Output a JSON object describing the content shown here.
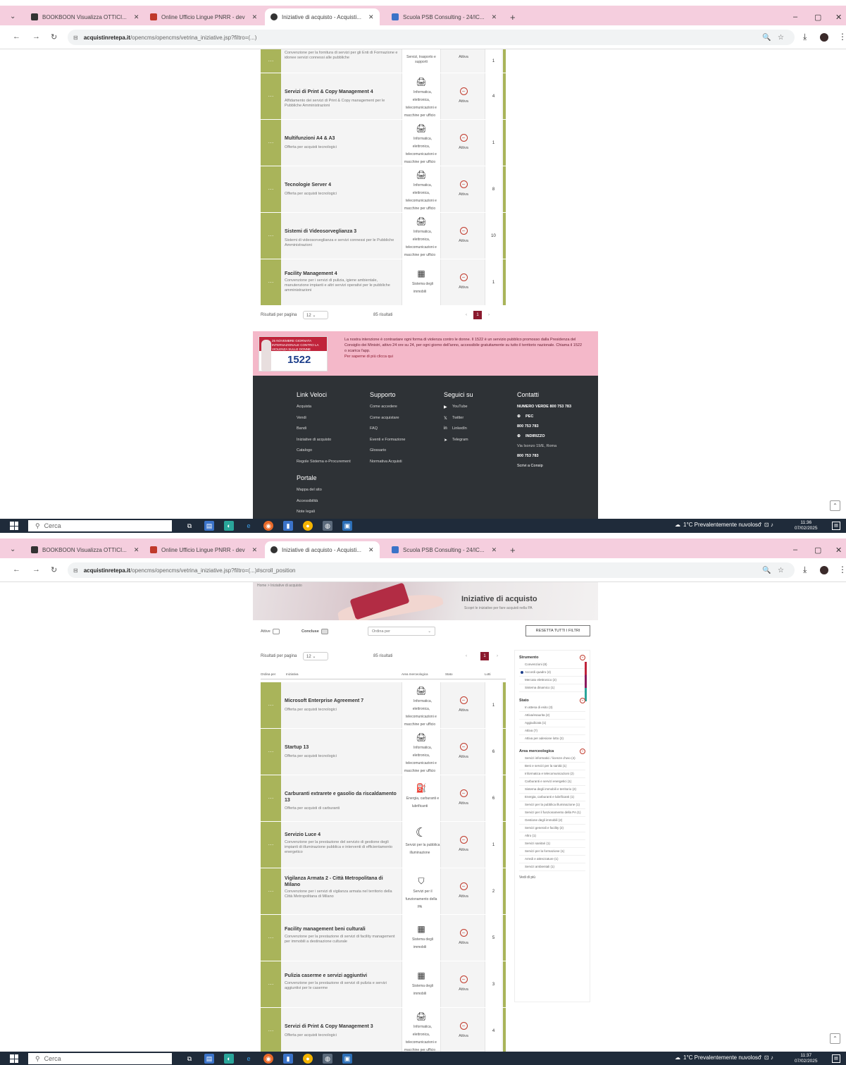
{
  "browser": {
    "tabs": [
      {
        "label": "BOOKBOON Visualizza OTTICI...",
        "color": "#333333"
      },
      {
        "label": "Online Ufficio Lingue PNRR - dev",
        "color": "#c0392b"
      },
      {
        "label": "Iniziative di acquisto - Acquisti...",
        "color": "#333333"
      },
      {
        "label": "Scuola PSB Consulting - 24/IC...",
        "color": "#3b73c8"
      }
    ],
    "new_tab": "+",
    "min": "–",
    "max": "▢",
    "close": "✕"
  },
  "screen1": {
    "url_host": "acquistinretepa.it",
    "url_path": "/opencms/opencms/vetrina_iniziative.jsp?filtro=(...)",
    "rows": [
      {
        "title": "",
        "desc": "Convenzione per la fornitura di servizi per gli Enti di Formazione e idonee servizi connessi alle pubbliche",
        "category": "Servizi, trasporto e supporti",
        "cat_icon": "🗎",
        "status": "Attiva",
        "num": "1"
      },
      {
        "title": "Servizi di Print & Copy Management 4",
        "desc": "Affidamento dei servizi di Print & Copy management per le Pubbliche Amministrazioni",
        "category": "Informatica, elettronica, telecomunicazioni e macchine per ufficio",
        "cat_icon": "🖨",
        "status": "Attiva",
        "num": "4"
      },
      {
        "title": "Multifunzioni A4 & A3",
        "desc": "Offerta per acquisti tecnologici",
        "category": "Informatica, elettronica, telecomunicazioni e macchine per ufficio",
        "cat_icon": "🖨",
        "status": "Attiva",
        "num": "1"
      },
      {
        "title": "Tecnologie Server 4",
        "desc": "Offerta per acquisti tecnologici",
        "category": "Informatica, elettronica, telecomunicazioni e macchine per ufficio",
        "cat_icon": "🖨",
        "status": "Attiva",
        "num": "8"
      },
      {
        "title": "Sistemi di Videosorveglianza 3",
        "desc": "Sistemi di videosorveglianza e servizi connessi per le Pubbliche Amministrazioni",
        "category": "Informatica, elettronica, telecomunicazioni e macchine per ufficio",
        "cat_icon": "🖨",
        "status": "Attiva",
        "num": "10"
      },
      {
        "title": "Facility Management 4",
        "desc": "Convenzione per i servizi di pulizia, igiene ambientale, manutenzione impianti e altri servizi operativi per le pubbliche amministrazioni",
        "category": "Sistema degli immobili",
        "cat_icon": "▦",
        "status": "Attiva",
        "num": "1"
      }
    ],
    "pager": {
      "label": "Risultati per pagina",
      "per_page": "12",
      "count": "85 risultati",
      "pages": [
        "‹",
        "1",
        "›"
      ]
    },
    "banner": {
      "logo_top": "25 NOVEMBRE GIORNATA INTERNAZIONALE CONTRO LA VIOLENZA SULLE DONNE",
      "logo_num": "1522",
      "text": "La nostra intenzione è contrastare ogni forma di violenza contro le donne. Il 1522 è un servizio pubblico promosso dalla Presidenza del Consiglio dei Ministri, attivo 24 ore su 24, per ogni giorno dell'anno, accessibile gratuitamente su tutto il territorio nazionale. Chiama il 1522 o scarica l'app.",
      "link": "Per saperne di più clicca qui"
    },
    "footer": {
      "quick_links": {
        "title": "Link Veloci",
        "items": [
          "Acquista",
          "Vendi",
          "Bandi",
          "Iniziative di acquisto",
          "Catalogo",
          "Regole Sistema e-Procurement"
        ]
      },
      "support": {
        "title": "Supporto",
        "items": [
          "Come accedere",
          "Come acquistare",
          "FAQ",
          "Eventi e Formazione",
          "Glossario",
          "Normativa Acquisti"
        ]
      },
      "follow": {
        "title": "Seguici su",
        "items": [
          "YouTube",
          "Twitter",
          "LinkedIn",
          "Telegram"
        ]
      },
      "contacts": {
        "title": "Contatti",
        "items": [
          "NUMERO VERDE 800 753 783",
          "PEC",
          "800 753 783",
          "INDIRIZZO",
          "Via Isonzo 19/E, Roma",
          "800 753 783",
          "Scrivi a Consip"
        ]
      },
      "portal": {
        "title": "Portale",
        "items": [
          "Mappa del sito",
          "Accessibilità",
          "Note legali"
        ]
      }
    }
  },
  "screen2": {
    "url_host": "acquistinretepa.it",
    "url_path": "/opencms/opencms/vetrina_iniziative.jsp?filtro=(...)#scroll_position",
    "breadcrumb": "Home > Iniziative di acquisto",
    "hero_title": "Iniziative di acquisto",
    "hero_sub": "Scopri le iniziative per fare acquisti nella PA",
    "filters": {
      "toggle1": "Attive",
      "toggle2": "Concluse",
      "dropdown": "Ordina per",
      "reset": "RESETTA TUTTI I FILTRI"
    },
    "pager": {
      "label": "Risultati per pagina",
      "per_page": "12",
      "count": "85 risultati",
      "pages": [
        "‹",
        "1",
        "›"
      ]
    },
    "col_headers": {
      "c1": "Ordina per",
      "c2": "Iniziativa",
      "c3": "Area merceologica",
      "c4": "Stato",
      "c5": "Lotti"
    },
    "rows": [
      {
        "title": "Microsoft Enterprise Agreement 7",
        "desc": "Offerta per acquisti tecnologici",
        "category": "Informatica, elettronica, telecomunicazioni e macchine per ufficio",
        "cat_icon": "🖨",
        "status": "Attiva",
        "num": "1"
      },
      {
        "title": "Startup 13",
        "desc": "Offerta per acquisti tecnologici",
        "category": "Informatica, elettronica, telecomunicazioni e macchine per ufficio",
        "cat_icon": "🖨",
        "status": "Attiva",
        "num": "6"
      },
      {
        "title": "Carburanti extrarete e gasolio da riscaldamento 13",
        "desc": "Offerta per acquisti di carburanti",
        "category": "Energia, carburanti e lubrificanti",
        "cat_icon": "⛽",
        "status": "Attiva",
        "num": "6"
      },
      {
        "title": "Servizio Luce 4",
        "desc": "Convenzione per la prestazione del servizio di gestione degli impianti di illuminazione pubblica e interventi di efficientamento energetico",
        "category": "Servizi per la pubblica illuminazione",
        "cat_icon": "☾",
        "status": "Attiva",
        "num": "1"
      },
      {
        "title": "Vigilanza Armata 2 - Città Metropolitana di Milano",
        "desc": "Convenzione per i servizi di vigilanza armata nel territorio della Città Metropolitana di Milano",
        "category": "Servizi per il funzionamento della PA",
        "cat_icon": "⛉",
        "status": "Attiva",
        "num": "2"
      },
      {
        "title": "Facility management beni culturali",
        "desc": "Convenzione per la prestazione di servizi di facility management per immobili a destinazione culturale",
        "category": "Sistema degli immobili",
        "cat_icon": "▦",
        "status": "Attiva",
        "num": "5"
      },
      {
        "title": "Pulizia caserme e servizi aggiuntivi",
        "desc": "Convenzione per la prestazione di servizi di pulizia e servizi aggiuntivi per le caserme",
        "category": "Sistema degli immobili",
        "cat_icon": "▦",
        "status": "Attiva",
        "num": "3"
      },
      {
        "title": "Servizi di Print & Copy Management 3",
        "desc": "Offerta per acquisti tecnologici",
        "category": "Informatica, elettronica, telecomunicazioni e macchine per ufficio",
        "cat_icon": "🖨",
        "status": "Attiva",
        "num": "4"
      }
    ],
    "sidebar": {
      "sec1": {
        "title": "Strumento",
        "options": [
          "Convenzioni (8)",
          "Accordi quadro (4)",
          "Mercato elettronico (2)",
          "Sistema dinamico (1)"
        ],
        "selected": 1
      },
      "sec2": {
        "title": "Stato",
        "options": [
          "In attesa di esito (3)",
          "Attiva/esaurita (2)",
          "Aggiudicata (1)",
          "Attiva (7)",
          "Attiva per adesione lotto (2)"
        ]
      },
      "sec3": {
        "title": "Area merceologica",
        "options": [
          "Servizi informatici / licenze d'uso (4)",
          "Beni e servizi per la sanità (1)",
          "Informatica e telecomunicazioni (2)",
          "Carburanti e servizi energetici (1)",
          "Sistema degli immobili e territorio (2)",
          "Energia, carburanti e lubrificanti (1)",
          "Servizi per la pubblica illuminazione (1)",
          "Servizi per il funzionamento della PA (1)",
          "Gestione degli immobili (2)",
          "Servizi generali e facility (2)",
          "Altro (1)",
          "Servizi sanitari (1)",
          "Servizi per la formazione (1)",
          "Arredi e attrezzature (1)",
          "Servizi ambientali (1)"
        ]
      },
      "more": "Vedi di più"
    }
  },
  "taskbar": {
    "search_placeholder": "Cerca",
    "weather": "1°C Prevalentemente nuvoloso",
    "time1": "11:36",
    "date1": "07/02/2025",
    "time2": "11:37",
    "date2": "07/02/2025"
  },
  "colors": {
    "tabstrip": "#f5cede",
    "accent_green": "#a9b45a",
    "accent_red": "#8b1a2e",
    "footer_bg": "#2e3236",
    "banner_bg": "#f4b8c9",
    "taskbar_bg": "#1f2b3a"
  }
}
